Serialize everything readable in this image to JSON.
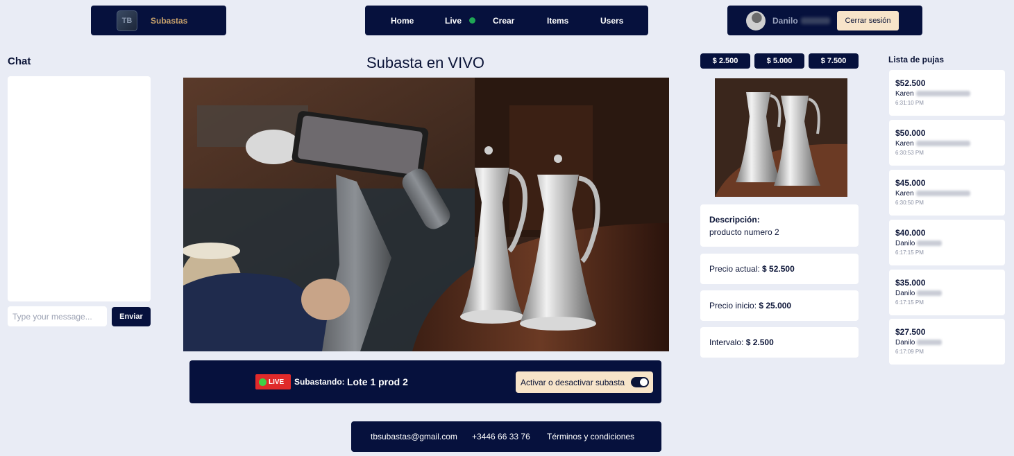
{
  "header": {
    "brand_logo_text": "TB",
    "brand_name": "Subastas",
    "nav": [
      {
        "label": "Home"
      },
      {
        "label": "Live"
      },
      {
        "label": "Crear"
      },
      {
        "label": "Items"
      },
      {
        "label": "Users"
      }
    ],
    "user_name": "Danilo",
    "logout_label": "Cerrar sesión",
    "live_indicator_color": "#1fa655"
  },
  "chat": {
    "title": "Chat",
    "input_placeholder": "Type your message...",
    "send_label": "Enviar"
  },
  "main": {
    "title": "Subasta en VIVO",
    "live_badge": "LIVE",
    "auctioning_label": "Subastando:",
    "auctioning_value": "Lote 1 prod 2",
    "toggle_label": "Activar o desactivar subasta",
    "toggle_on": true
  },
  "quick_bids": [
    "$ 2.500",
    "$ 5.000",
    "$ 7.500"
  ],
  "item": {
    "description_label": "Descripción:",
    "description_value": "producto numero 2",
    "current_price_label": "Precio actual:",
    "current_price_value": "$ 52.500",
    "start_price_label": "Precio inicio:",
    "start_price_value": "$ 25.000",
    "interval_label": "Intervalo:",
    "interval_value": "$ 2.500"
  },
  "bids": {
    "title": "Lista de pujas",
    "items": [
      {
        "amount": "$52.500",
        "user": "Karen",
        "time": "6:31:10 PM"
      },
      {
        "amount": "$50.000",
        "user": "Karen",
        "time": "6:30:53 PM"
      },
      {
        "amount": "$45.000",
        "user": "Karen",
        "time": "6:30:50 PM"
      },
      {
        "amount": "$40.000",
        "user": "Danilo",
        "time": "6:17:15 PM"
      },
      {
        "amount": "$35.000",
        "user": "Danilo",
        "time": "6:17:15 PM"
      },
      {
        "amount": "$27.500",
        "user": "Danilo",
        "time": "6:17:09 PM"
      }
    ]
  },
  "footer": {
    "email": "tbsubastas@gmail.com",
    "phone": "+3446 66 33 76",
    "terms": "Términos y condiciones"
  },
  "colors": {
    "navy": "#06113d",
    "background": "#e9ecf5",
    "cream": "#f7e4c9",
    "live_red": "#e02a2a",
    "live_green": "#3fd046"
  }
}
